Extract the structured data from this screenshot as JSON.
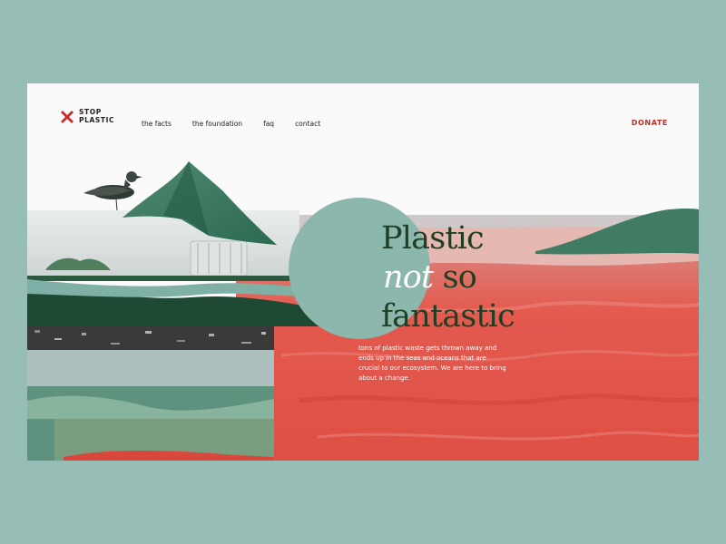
{
  "brand": {
    "line1": "STOP",
    "line2": "PLASTIC"
  },
  "nav": {
    "items": [
      {
        "label": "the facts"
      },
      {
        "label": "the foundation"
      },
      {
        "label": "faq"
      },
      {
        "label": "contact"
      }
    ],
    "donate_label": "DONATE"
  },
  "hero": {
    "title_line1": "Plastic",
    "title_word_italic": "not",
    "title_word_after": "so",
    "title_line3": "fantastic",
    "body": "tons of plastic waste gets thrown away and ends up in the seas and oceans that are crucial to our ecosystem. We are here to bring about a change."
  },
  "colors": {
    "page_background": "#96bdb6",
    "frame_background": "#fbfafb",
    "accent_red": "#b82e24",
    "headline_green": "#1e3f24",
    "mountain_green": "#2f6e53",
    "sea_red": "#e2554b",
    "circle_mint": "#8bb7ac"
  },
  "icons": {
    "logo": "x-cross-icon",
    "bird": "seagull-illustration"
  }
}
